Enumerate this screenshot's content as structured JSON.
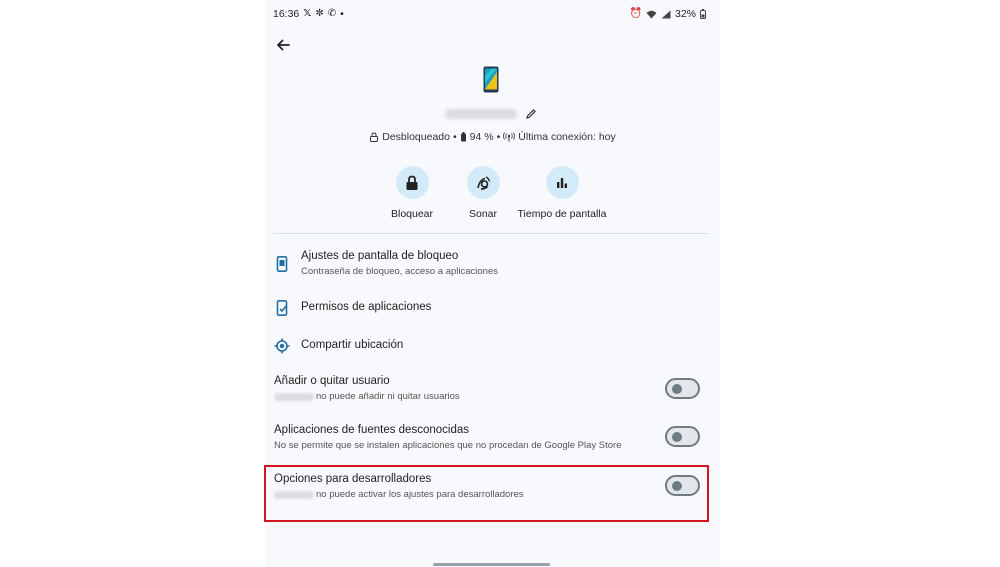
{
  "status_bar": {
    "time": "16:36",
    "notif_icons": [
      "x-icon",
      "pinwheel-icon",
      "whatsapp-icon"
    ],
    "dot": "•",
    "battery": "32%"
  },
  "device": {
    "info": {
      "lock": "Desbloqueado",
      "sep1": "•",
      "battery": "94 %",
      "sep2": "•",
      "connection": "Última conexión: hoy"
    }
  },
  "actions": [
    {
      "label": "Bloquear",
      "icon": "lock-icon"
    },
    {
      "label": "Sonar",
      "icon": "ring-icon"
    },
    {
      "label": "Tiempo de pantalla",
      "icon": "bar-chart-icon"
    }
  ],
  "settings": {
    "lock_screen": {
      "title": "Ajustes de pantalla de bloqueo",
      "subtitle": "Contraseña de bloqueo, acceso a aplicaciones"
    },
    "app_permissions": {
      "title": "Permisos de aplicaciones"
    },
    "share_location": {
      "title": "Compartir ubicación"
    },
    "add_user": {
      "title": "Añadir o quitar usuario",
      "subtitle": "no puede añadir ni quitar usuarios",
      "enabled": false
    },
    "unknown_sources": {
      "title": "Aplicaciones de fuentes desconocidas",
      "subtitle": "No se permite que se instalen aplicaciones que no procedan de Google Play Store",
      "enabled": false
    },
    "dev_options": {
      "title": "Opciones para desarrolladores",
      "subtitle": "no puede activar los ajustes para desarrolladores",
      "enabled": false
    }
  },
  "colors": {
    "accent_circle": "#d3ebf8",
    "highlight": "#d3161e",
    "icon_primary": "#1f6fa3"
  }
}
